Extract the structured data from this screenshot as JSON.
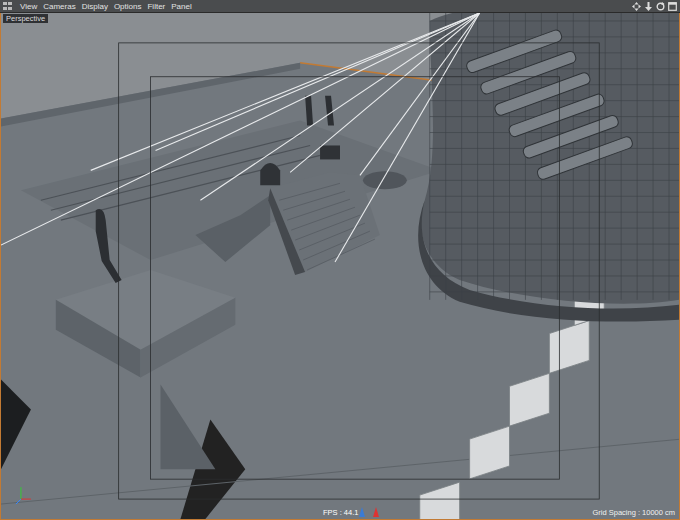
{
  "menu": [
    "View",
    "Cameras",
    "Display",
    "Options",
    "Filter",
    "Panel"
  ],
  "viewport": {
    "camera": "Perspective",
    "fps": "FPS : 44.1",
    "grid_spacing": "Grid Spacing : 10000 cm"
  }
}
